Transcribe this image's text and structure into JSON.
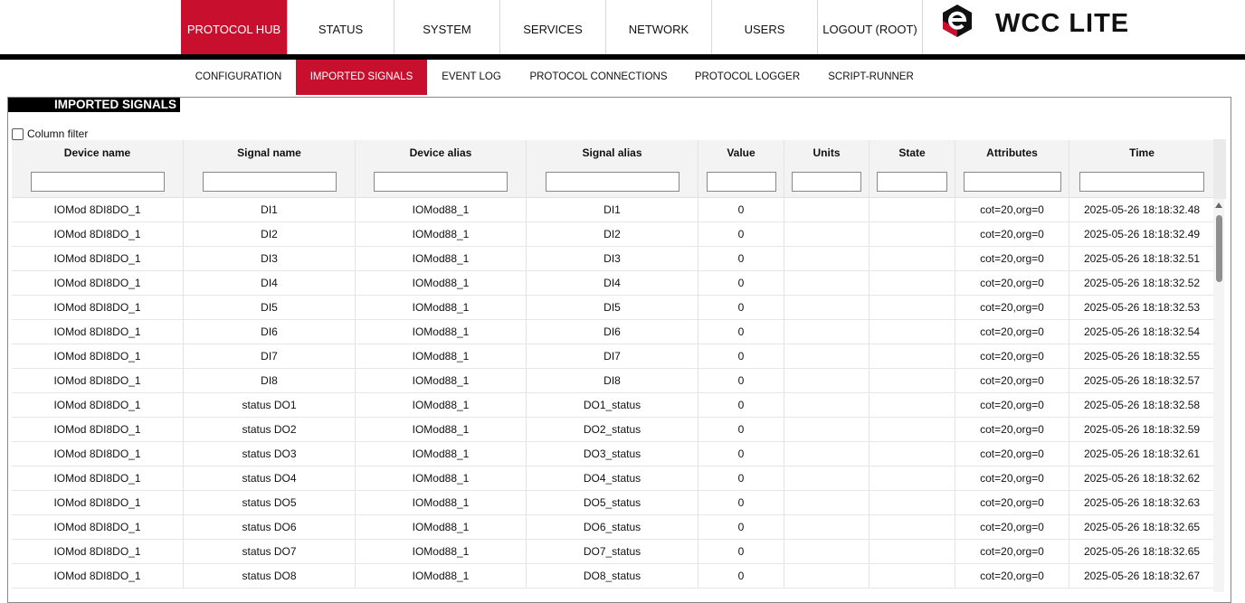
{
  "topnav": {
    "tabs": [
      {
        "label": "PROTOCOL HUB",
        "active": true
      },
      {
        "label": "STATUS",
        "active": false
      },
      {
        "label": "SYSTEM",
        "active": false
      },
      {
        "label": "SERVICES",
        "active": false
      },
      {
        "label": "NETWORK",
        "active": false
      },
      {
        "label": "USERS",
        "active": false
      },
      {
        "label": "LOGOUT (ROOT)",
        "active": false
      }
    ],
    "logo_text": "WCC LITE",
    "logo_icon": "e-logo-icon",
    "accent_color": "#c8102e"
  },
  "subnav": {
    "tabs": [
      {
        "label": "CONFIGURATION",
        "active": false
      },
      {
        "label": "IMPORTED SIGNALS",
        "active": true
      },
      {
        "label": "EVENT LOG",
        "active": false
      },
      {
        "label": "PROTOCOL CONNECTIONS",
        "active": false
      },
      {
        "label": "PROTOCOL LOGGER",
        "active": false
      },
      {
        "label": "SCRIPT-RUNNER",
        "active": false
      }
    ]
  },
  "panel": {
    "title": "IMPORTED SIGNALS",
    "column_filter_label": "Column filter",
    "column_filter_checked": false
  },
  "table": {
    "columns": [
      "Device name",
      "Signal name",
      "Device alias",
      "Signal alias",
      "Value",
      "Units",
      "State",
      "Attributes",
      "Time"
    ],
    "rows": [
      [
        "IOMod 8DI8DO_1",
        "DI1",
        "IOMod88_1",
        "DI1",
        "0",
        "",
        "",
        "cot=20,org=0",
        "2025-05-26 18:18:32.48"
      ],
      [
        "IOMod 8DI8DO_1",
        "DI2",
        "IOMod88_1",
        "DI2",
        "0",
        "",
        "",
        "cot=20,org=0",
        "2025-05-26 18:18:32.49"
      ],
      [
        "IOMod 8DI8DO_1",
        "DI3",
        "IOMod88_1",
        "DI3",
        "0",
        "",
        "",
        "cot=20,org=0",
        "2025-05-26 18:18:32.51"
      ],
      [
        "IOMod 8DI8DO_1",
        "DI4",
        "IOMod88_1",
        "DI4",
        "0",
        "",
        "",
        "cot=20,org=0",
        "2025-05-26 18:18:32.52"
      ],
      [
        "IOMod 8DI8DO_1",
        "DI5",
        "IOMod88_1",
        "DI5",
        "0",
        "",
        "",
        "cot=20,org=0",
        "2025-05-26 18:18:32.53"
      ],
      [
        "IOMod 8DI8DO_1",
        "DI6",
        "IOMod88_1",
        "DI6",
        "0",
        "",
        "",
        "cot=20,org=0",
        "2025-05-26 18:18:32.54"
      ],
      [
        "IOMod 8DI8DO_1",
        "DI7",
        "IOMod88_1",
        "DI7",
        "0",
        "",
        "",
        "cot=20,org=0",
        "2025-05-26 18:18:32.55"
      ],
      [
        "IOMod 8DI8DO_1",
        "DI8",
        "IOMod88_1",
        "DI8",
        "0",
        "",
        "",
        "cot=20,org=0",
        "2025-05-26 18:18:32.57"
      ],
      [
        "IOMod 8DI8DO_1",
        "status DO1",
        "IOMod88_1",
        "DO1_status",
        "0",
        "",
        "",
        "cot=20,org=0",
        "2025-05-26 18:18:32.58"
      ],
      [
        "IOMod 8DI8DO_1",
        "status DO2",
        "IOMod88_1",
        "DO2_status",
        "0",
        "",
        "",
        "cot=20,org=0",
        "2025-05-26 18:18:32.59"
      ],
      [
        "IOMod 8DI8DO_1",
        "status DO3",
        "IOMod88_1",
        "DO3_status",
        "0",
        "",
        "",
        "cot=20,org=0",
        "2025-05-26 18:18:32.61"
      ],
      [
        "IOMod 8DI8DO_1",
        "status DO4",
        "IOMod88_1",
        "DO4_status",
        "0",
        "",
        "",
        "cot=20,org=0",
        "2025-05-26 18:18:32.62"
      ],
      [
        "IOMod 8DI8DO_1",
        "status DO5",
        "IOMod88_1",
        "DO5_status",
        "0",
        "",
        "",
        "cot=20,org=0",
        "2025-05-26 18:18:32.63"
      ],
      [
        "IOMod 8DI8DO_1",
        "status DO6",
        "IOMod88_1",
        "DO6_status",
        "0",
        "",
        "",
        "cot=20,org=0",
        "2025-05-26 18:18:32.65"
      ],
      [
        "IOMod 8DI8DO_1",
        "status DO7",
        "IOMod88_1",
        "DO7_status",
        "0",
        "",
        "",
        "cot=20,org=0",
        "2025-05-26 18:18:32.65"
      ],
      [
        "IOMod 8DI8DO_1",
        "status DO8",
        "IOMod88_1",
        "DO8_status",
        "0",
        "",
        "",
        "cot=20,org=0",
        "2025-05-26 18:18:32.67"
      ]
    ]
  }
}
